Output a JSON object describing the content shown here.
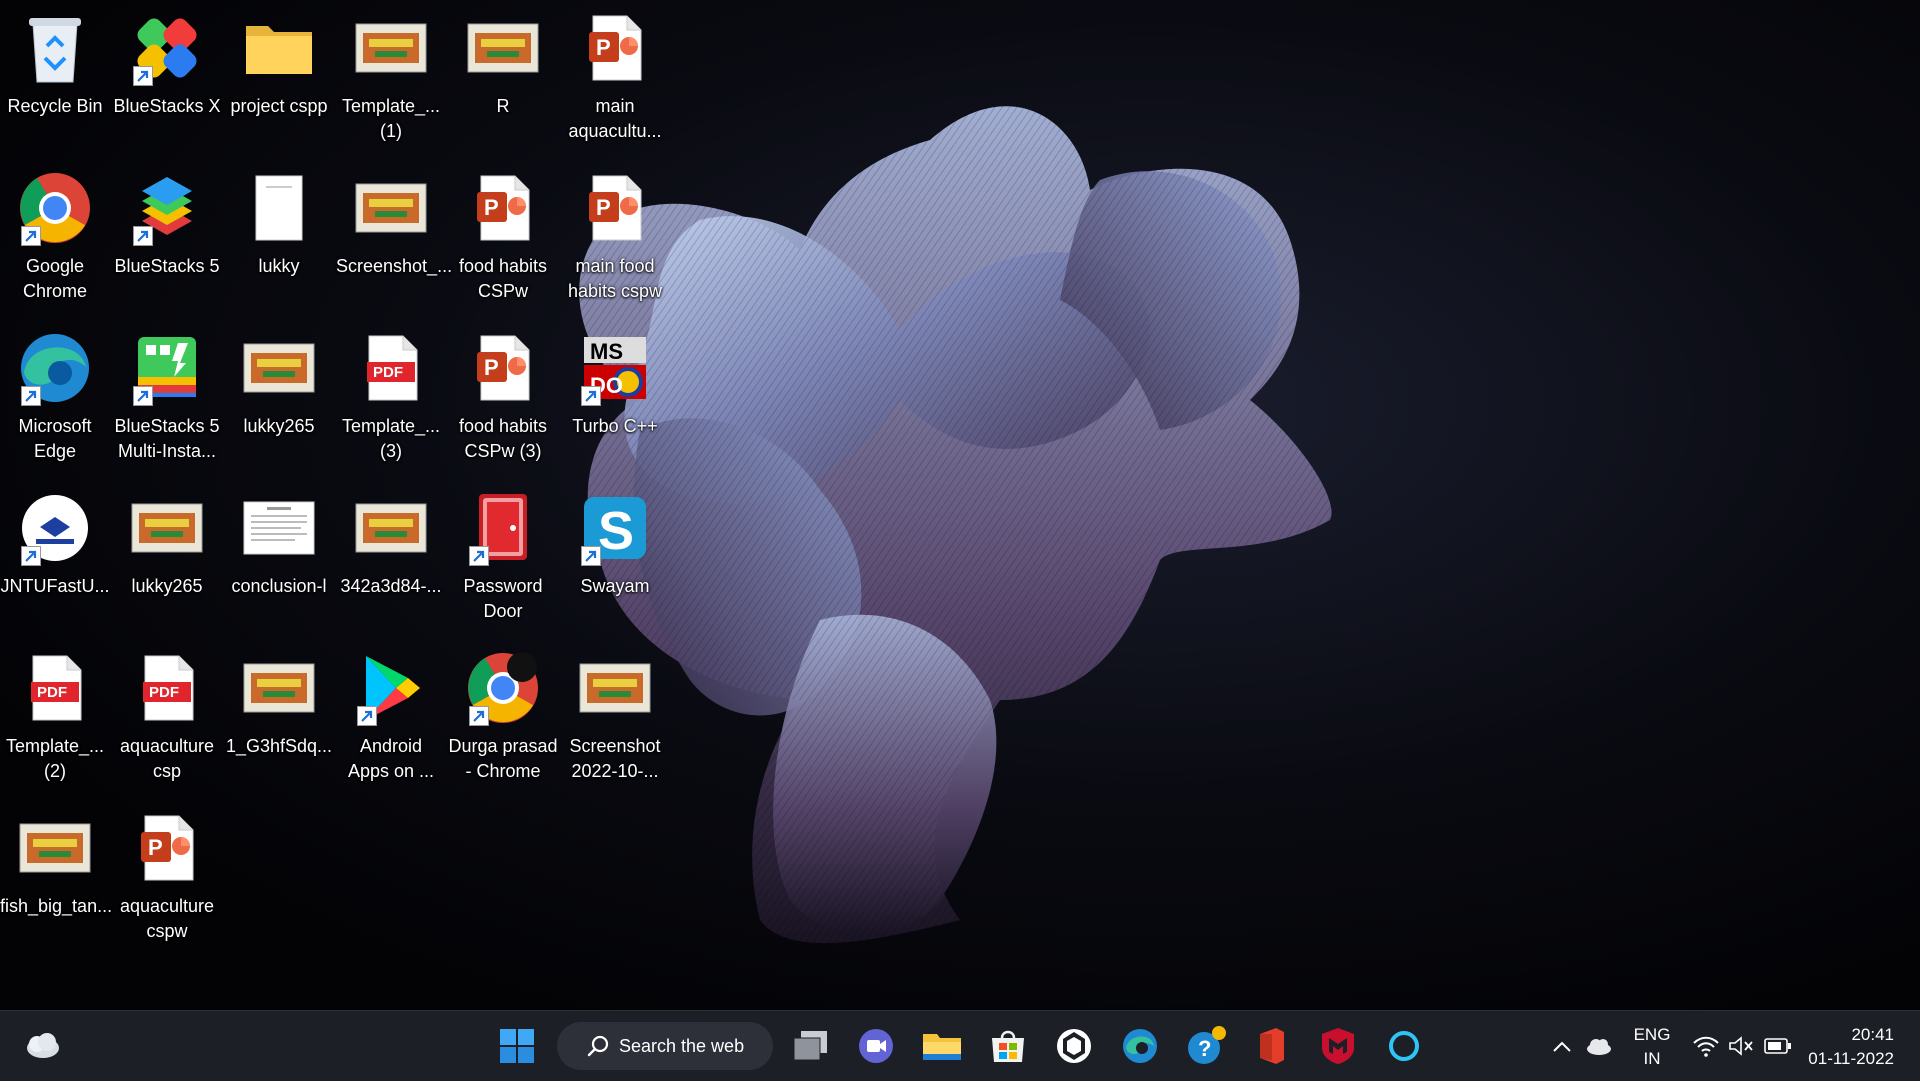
{
  "desktop": {
    "icons": [
      {
        "label": "Recycle Bin",
        "icon": "recycle-bin-icon"
      },
      {
        "label": "BlueStacks X",
        "icon": "bluestacks-x-icon"
      },
      {
        "label": "project cspp",
        "icon": "folder-icon"
      },
      {
        "label": "Template_...\n(1)",
        "icon": "image-thumbnail-icon"
      },
      {
        "label": "R",
        "icon": "image-thumbnail-icon"
      },
      {
        "label": "main\naquacultu...",
        "icon": "powerpoint-file-icon"
      },
      {
        "label": "Google\nChrome",
        "icon": "chrome-icon"
      },
      {
        "label": "BlueStacks 5",
        "icon": "bluestacks-icon"
      },
      {
        "label": "lukky",
        "icon": "document-icon"
      },
      {
        "label": "Screenshot_...",
        "icon": "image-thumbnail-icon"
      },
      {
        "label": "food habits\nCSPw",
        "icon": "powerpoint-file-icon"
      },
      {
        "label": "main food\nhabits cspw",
        "icon": "powerpoint-file-icon"
      },
      {
        "label": "Microsoft\nEdge",
        "icon": "edge-icon"
      },
      {
        "label": "BlueStacks 5\nMulti-Insta...",
        "icon": "bluestacks-multi-icon"
      },
      {
        "label": "lukky265",
        "icon": "image-thumbnail-icon"
      },
      {
        "label": "Template_...\n(3)",
        "icon": "pdf-file-icon"
      },
      {
        "label": "food habits\nCSPw (3)",
        "icon": "powerpoint-file-icon"
      },
      {
        "label": "Turbo C++",
        "icon": "turbo-cpp-icon"
      },
      {
        "label": "JNTUFastU...",
        "icon": "jntu-icon"
      },
      {
        "label": "lukky265",
        "icon": "image-thumbnail-icon"
      },
      {
        "label": "conclusion-l",
        "icon": "document-thumbnail-icon"
      },
      {
        "label": "342a3d84-...",
        "icon": "image-thumbnail-icon"
      },
      {
        "label": "Password\nDoor",
        "icon": "password-door-icon"
      },
      {
        "label": "Swayam",
        "icon": "swayam-icon"
      },
      {
        "label": "Template_...\n(2)",
        "icon": "pdf-file-icon"
      },
      {
        "label": "aquaculture\ncsp",
        "icon": "pdf-file-icon"
      },
      {
        "label": "1_G3hfSdq...",
        "icon": "image-thumbnail-icon"
      },
      {
        "label": "Android\nApps on ...",
        "icon": "play-store-icon"
      },
      {
        "label": "Durga prasad\n- Chrome",
        "icon": "chrome-profile-icon"
      },
      {
        "label": "Screenshot\n2022-10-...",
        "icon": "image-thumbnail-icon"
      },
      {
        "label": "fish_big_tan...",
        "icon": "image-thumbnail-icon"
      },
      {
        "label": "aquaculture\ncspw",
        "icon": "powerpoint-file-icon"
      }
    ]
  },
  "taskbar": {
    "search_label": "Search the web",
    "language": "ENG",
    "region": "IN",
    "time": "20:41",
    "date": "01-11-2022",
    "icons": [
      "weather-icon",
      "start-icon",
      "search-icon",
      "task-view-icon",
      "teams-chat-icon",
      "file-explorer-icon",
      "microsoft-store-icon",
      "widget-app-icon",
      "edge-icon",
      "get-help-icon",
      "office-icon",
      "mcafee-icon",
      "cortana-icon",
      "chevron-up-icon",
      "onedrive-icon",
      "wifi-icon",
      "speaker-muted-icon",
      "battery-icon"
    ]
  },
  "colors": {
    "taskbar_bg": "#1c1f26",
    "accent_blue": "#1e90ff",
    "ppt_orange": "#c43e1c",
    "pdf_red": "#e0262c"
  }
}
